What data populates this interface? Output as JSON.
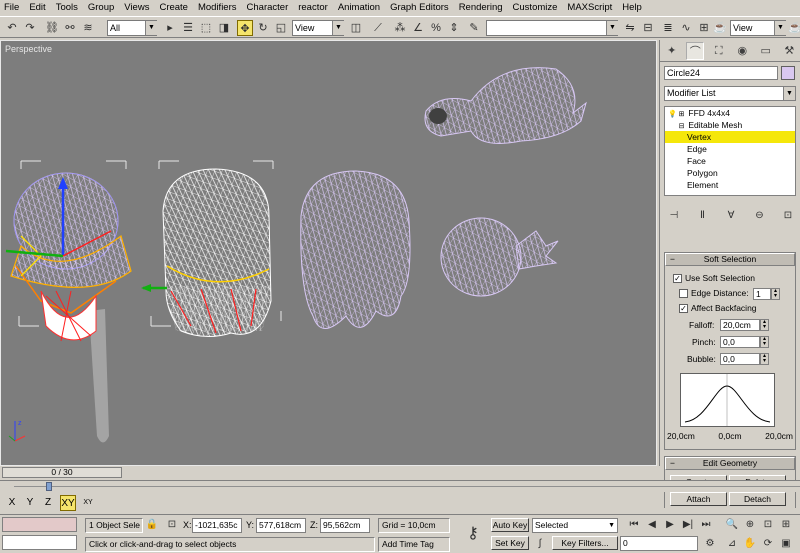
{
  "menu": [
    "File",
    "Edit",
    "Tools",
    "Group",
    "Views",
    "Create",
    "Modifiers",
    "Character",
    "reactor",
    "Animation",
    "Graph Editors",
    "Rendering",
    "Customize",
    "MAXScript",
    "Help"
  ],
  "toolbar": {
    "selection_filter": "All",
    "ref_coord": "View",
    "named_selection": "",
    "render_view": "View"
  },
  "viewport": {
    "label": "Perspective"
  },
  "command_panel": {
    "object_name": "Circle24",
    "object_color": "#d9c8f0",
    "modifier_list": "Modifier List",
    "stack": [
      {
        "label": "FFD 4x4x4",
        "indent": 0,
        "expander": "+"
      },
      {
        "label": "Editable Mesh",
        "indent": 0,
        "expander": "-"
      },
      {
        "label": "Vertex",
        "indent": 1,
        "selected": true
      },
      {
        "label": "Edge",
        "indent": 1
      },
      {
        "label": "Face",
        "indent": 1
      },
      {
        "label": "Polygon",
        "indent": 1
      },
      {
        "label": "Element",
        "indent": 1
      }
    ],
    "soft_selection": {
      "title": "Soft Selection",
      "use_soft_selection": "Use Soft Selection",
      "edge_distance": "Edge Distance:",
      "edge_distance_value": "1",
      "affect_backfacing": "Affect Backfacing",
      "falloff_label": "Falloff:",
      "falloff_value": "20,0cm",
      "pinch_label": "Pinch:",
      "pinch_value": "0,0",
      "bubble_label": "Bubble:",
      "bubble_value": "0,0",
      "graph_left": "20,0cm",
      "graph_mid": "0,0cm",
      "graph_right": "20,0cm"
    },
    "edit_geometry": {
      "title": "Edit Geometry",
      "create": "Create",
      "delete": "Delete",
      "attach": "Attach",
      "detach": "Detach"
    }
  },
  "time": {
    "slider": "0 / 30"
  },
  "axis": {
    "x": "X",
    "y": "Y",
    "z": "Z",
    "xy": "XY",
    "xy2": "XY"
  },
  "status": {
    "selection": "1 Object Sele",
    "x_label": "X:",
    "x_value": "-1021,635c",
    "y_label": "Y:",
    "y_value": "577,618cm",
    "z_label": "Z:",
    "z_value": "95,562cm",
    "grid": "Grid = 10,0cm",
    "prompt": "Click or click-and-drag to select objects",
    "add_time_tag": "Add Time Tag",
    "auto_key": "Auto Key",
    "set_key": "Set Key",
    "key_mode": "Selected",
    "key_filters": "Key Filters...",
    "frame": "0"
  },
  "colors": {
    "wire": "#d8c8f4",
    "viewport_bg": "#7d7d7d",
    "selected_stack": "#f5e70a"
  }
}
